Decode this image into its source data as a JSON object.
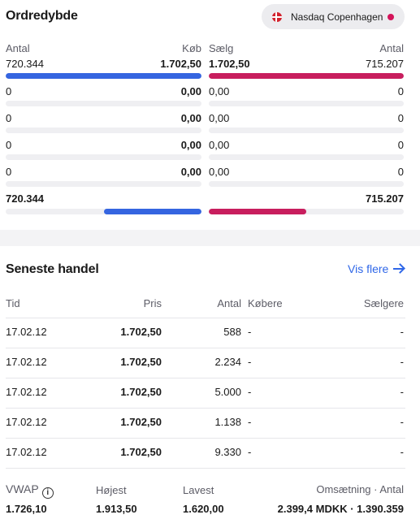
{
  "orderbook": {
    "title": "Ordredybde",
    "exchange": "Nasdaq Copenhagen",
    "headers": {
      "bid_qty": "Antal",
      "bid_price": "Køb",
      "ask_price": "Sælg",
      "ask_qty": "Antal"
    },
    "rows": [
      {
        "bid_qty": "720.344",
        "bid_price": "1.702,50",
        "ask_price": "1.702,50",
        "ask_qty": "715.207",
        "bid_fill": 1.0,
        "ask_fill": 1.0
      },
      {
        "bid_qty": "0",
        "bid_price": "0,00",
        "ask_price": "0,00",
        "ask_qty": "0",
        "bid_fill": 0,
        "ask_fill": 0
      },
      {
        "bid_qty": "0",
        "bid_price": "0,00",
        "ask_price": "0,00",
        "ask_qty": "0",
        "bid_fill": 0,
        "ask_fill": 0
      },
      {
        "bid_qty": "0",
        "bid_price": "0,00",
        "ask_price": "0,00",
        "ask_qty": "0",
        "bid_fill": 0,
        "ask_fill": 0
      },
      {
        "bid_qty": "0",
        "bid_price": "0,00",
        "ask_price": "0,00",
        "ask_qty": "0",
        "bid_fill": 0,
        "ask_fill": 0
      }
    ],
    "total": {
      "bid_qty": "720.344",
      "ask_qty": "715.207",
      "bid_fill": 0.5,
      "ask_fill": 0.5
    },
    "colors": {
      "bid": "#3565e0",
      "ask": "#c81e5e"
    }
  },
  "trades": {
    "title": "Seneste handel",
    "see_more": "Vis flere",
    "columns": {
      "time": "Tid",
      "price": "Pris",
      "qty": "Antal",
      "buyer": "Købere",
      "seller": "Sælgere"
    },
    "rows": [
      {
        "time": "17.02.12",
        "price": "1.702,50",
        "qty": "588",
        "buyer": "-",
        "seller": "-"
      },
      {
        "time": "17.02.12",
        "price": "1.702,50",
        "qty": "2.234",
        "buyer": "-",
        "seller": "-"
      },
      {
        "time": "17.02.12",
        "price": "1.702,50",
        "qty": "5.000",
        "buyer": "-",
        "seller": "-"
      },
      {
        "time": "17.02.12",
        "price": "1.702,50",
        "qty": "1.138",
        "buyer": "-",
        "seller": "-"
      },
      {
        "time": "17.02.12",
        "price": "1.702,50",
        "qty": "9.330",
        "buyer": "-",
        "seller": "-"
      }
    ],
    "summary": {
      "vwap_label": "VWAP",
      "vwap": "1.726,10",
      "high_label": "Højest",
      "high": "1.913,50",
      "low_label": "Lavest",
      "low": "1.620,00",
      "turnover_label": "Omsætning · Antal",
      "turnover": "2.399,4 MDKK · 1.390.359"
    }
  }
}
